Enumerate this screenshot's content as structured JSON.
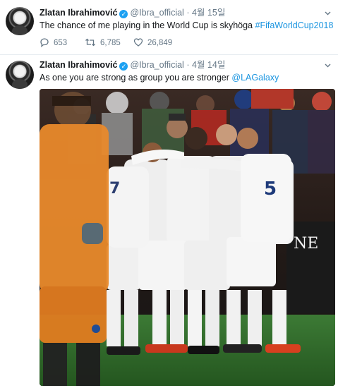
{
  "tweets": [
    {
      "name": "Zlatan Ibrahimović",
      "handle": "@Ibra_official",
      "separator": "·",
      "date": "4월 15일",
      "text_plain": "The chance of me playing in the World Cup is skyhöga",
      "hashtag": "#FifaWorldCup2018",
      "replies": "653",
      "retweets": "6,785",
      "likes": "26,849"
    },
    {
      "name": "Zlatan Ibrahimović",
      "handle": "@Ibra_official",
      "separator": "·",
      "date": "4월 14일",
      "text_plain": "As one you are strong as group you are stronger",
      "mention": "@LAGalaxy"
    }
  ],
  "photo": {
    "sign_text": "NE",
    "jersey_number_left": "7",
    "jersey_number_right": "5"
  },
  "colors": {
    "link": "#1b95e0",
    "verified": "#1da1f2",
    "muted": "#657786",
    "keeper_orange": "#e98a2c",
    "pitch_green": "#2f6a2c"
  },
  "icons": [
    "verified-badge-icon",
    "chevron-down-icon",
    "reply-icon",
    "retweet-icon",
    "like-icon"
  ]
}
